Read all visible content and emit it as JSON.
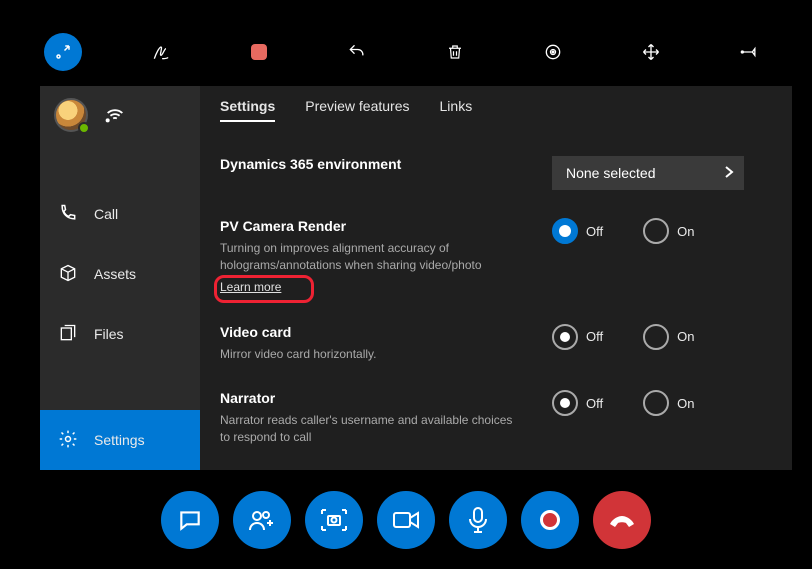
{
  "top_toolbar": {
    "icons": [
      "move-resize",
      "ink",
      "record-shape",
      "undo",
      "delete",
      "focus-target",
      "move-handles",
      "pin"
    ]
  },
  "sidebar": {
    "items": [
      {
        "label": "Call",
        "icon": "phone-icon"
      },
      {
        "label": "Assets",
        "icon": "cube-icon"
      },
      {
        "label": "Files",
        "icon": "files-icon"
      },
      {
        "label": "Settings",
        "icon": "gear-icon"
      }
    ],
    "selected_index": 3
  },
  "tabs": {
    "items": [
      "Settings",
      "Preview features",
      "Links"
    ],
    "active_index": 0
  },
  "labels": {
    "off": "Off",
    "on": "On"
  },
  "settings": {
    "env": {
      "title": "Dynamics 365 environment",
      "value": "None selected"
    },
    "pv": {
      "title": "PV Camera Render",
      "desc": "Turning on improves alignment accuracy of holograms/annotations when sharing video/photo",
      "learn": "Learn more",
      "value": "off"
    },
    "video_card": {
      "title": "Video card",
      "desc": "Mirror video card horizontally.",
      "value": "off"
    },
    "narrator": {
      "title": "Narrator",
      "desc": "Narrator reads caller's username and available choices to respond to call",
      "value": "off"
    }
  },
  "bottom_bar": {
    "buttons": [
      "chat",
      "people-add",
      "capture-camera",
      "video",
      "mic",
      "record",
      "hangup"
    ]
  }
}
